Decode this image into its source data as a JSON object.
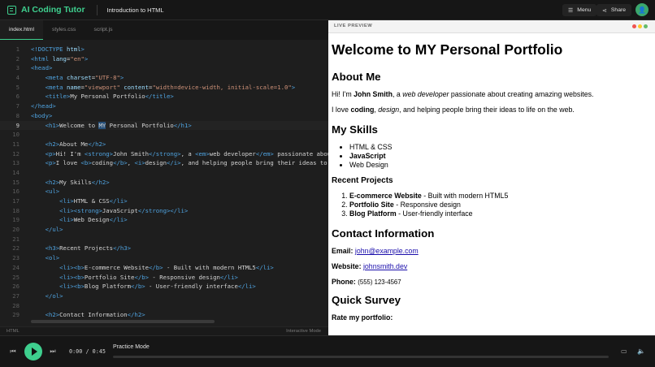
{
  "app": {
    "brand": "AI Coding Tutor",
    "lesson": "Introduction to HTML",
    "menu_label": "Menu",
    "share_label": "Share"
  },
  "colors": {
    "accent": "#3ecf8e",
    "tag": "#4fa3e0",
    "attr": "#9cdcfe",
    "string": "#ce9178",
    "editor_bg": "#1e1e1e"
  },
  "editor": {
    "tabs": [
      "index.html",
      "styles.css",
      "script.js"
    ],
    "active_tab": 0,
    "current_line": 9,
    "lines": [
      [
        [
          "t",
          "<!DOCTYPE "
        ],
        [
          "a",
          "html"
        ],
        [
          "t",
          ">"
        ]
      ],
      [
        [
          "t",
          "<html "
        ],
        [
          "a",
          "lang"
        ],
        [
          "x",
          "="
        ],
        [
          "s",
          "\"en\""
        ],
        [
          "t",
          ">"
        ]
      ],
      [
        [
          "t",
          "<head>"
        ]
      ],
      [
        [
          "x",
          "    "
        ],
        [
          "t",
          "<meta "
        ],
        [
          "a",
          "charset"
        ],
        [
          "x",
          "="
        ],
        [
          "s",
          "\"UTF-8\""
        ],
        [
          "t",
          ">"
        ]
      ],
      [
        [
          "x",
          "    "
        ],
        [
          "t",
          "<meta "
        ],
        [
          "a",
          "name"
        ],
        [
          "x",
          "="
        ],
        [
          "s",
          "\"viewport\""
        ],
        [
          "x",
          " "
        ],
        [
          "a",
          "content"
        ],
        [
          "x",
          "="
        ],
        [
          "s",
          "\"width=device-width, initial-scale=1.0\""
        ],
        [
          "t",
          ">"
        ]
      ],
      [
        [
          "x",
          "    "
        ],
        [
          "t",
          "<title>"
        ],
        [
          "x",
          "My Personal Portfolio"
        ],
        [
          "t",
          "</title>"
        ]
      ],
      [
        [
          "t",
          "</head>"
        ]
      ],
      [
        [
          "t",
          "<body>"
        ]
      ],
      [
        [
          "x",
          "    "
        ],
        [
          "t",
          "<h1>"
        ],
        [
          "x",
          "Welcome to "
        ],
        [
          "h",
          "MY"
        ],
        [
          "x",
          " Personal Portfolio"
        ],
        [
          "t",
          "</h1>"
        ]
      ],
      [
        [
          "x",
          ""
        ]
      ],
      [
        [
          "x",
          "    "
        ],
        [
          "t",
          "<h2>"
        ],
        [
          "x",
          "About Me"
        ],
        [
          "t",
          "</h2>"
        ]
      ],
      [
        [
          "x",
          "    "
        ],
        [
          "t",
          "<p>"
        ],
        [
          "x",
          "Hi! I'm "
        ],
        [
          "t",
          "<strong>"
        ],
        [
          "x",
          "John Smith"
        ],
        [
          "t",
          "</strong>"
        ],
        [
          "x",
          ", a "
        ],
        [
          "t",
          "<em>"
        ],
        [
          "x",
          "web developer"
        ],
        [
          "t",
          "</em>"
        ],
        [
          "x",
          " passionate about creating amazing websites."
        ],
        [
          "t",
          "</p>"
        ]
      ],
      [
        [
          "x",
          "    "
        ],
        [
          "t",
          "<p>"
        ],
        [
          "x",
          "I love "
        ],
        [
          "t",
          "<b>"
        ],
        [
          "x",
          "coding"
        ],
        [
          "t",
          "</b>"
        ],
        [
          "x",
          ", "
        ],
        [
          "t",
          "<i>"
        ],
        [
          "x",
          "design"
        ],
        [
          "t",
          "</i>"
        ],
        [
          "x",
          ", and helping people bring their ideas to life on the web."
        ],
        [
          "t",
          "</p>"
        ]
      ],
      [
        [
          "x",
          ""
        ]
      ],
      [
        [
          "x",
          "    "
        ],
        [
          "t",
          "<h2>"
        ],
        [
          "x",
          "My Skills"
        ],
        [
          "t",
          "</h2>"
        ]
      ],
      [
        [
          "x",
          "    "
        ],
        [
          "t",
          "<ul>"
        ]
      ],
      [
        [
          "x",
          "        "
        ],
        [
          "t",
          "<li>"
        ],
        [
          "x",
          "HTML & CSS"
        ],
        [
          "t",
          "</li>"
        ]
      ],
      [
        [
          "x",
          "        "
        ],
        [
          "t",
          "<li><strong>"
        ],
        [
          "x",
          "JavaScript"
        ],
        [
          "t",
          "</strong></li>"
        ]
      ],
      [
        [
          "x",
          "        "
        ],
        [
          "t",
          "<li>"
        ],
        [
          "x",
          "Web Design"
        ],
        [
          "t",
          "</li>"
        ]
      ],
      [
        [
          "x",
          "    "
        ],
        [
          "t",
          "</ul>"
        ]
      ],
      [
        [
          "x",
          ""
        ]
      ],
      [
        [
          "x",
          "    "
        ],
        [
          "t",
          "<h3>"
        ],
        [
          "x",
          "Recent Projects"
        ],
        [
          "t",
          "</h3>"
        ]
      ],
      [
        [
          "x",
          "    "
        ],
        [
          "t",
          "<ol>"
        ]
      ],
      [
        [
          "x",
          "        "
        ],
        [
          "t",
          "<li><b>"
        ],
        [
          "x",
          "E-commerce Website"
        ],
        [
          "t",
          "</b>"
        ],
        [
          "x",
          " - Built with modern HTML5"
        ],
        [
          "t",
          "</li>"
        ]
      ],
      [
        [
          "x",
          "        "
        ],
        [
          "t",
          "<li><b>"
        ],
        [
          "x",
          "Portfolio Site"
        ],
        [
          "t",
          "</b>"
        ],
        [
          "x",
          " - Responsive design"
        ],
        [
          "t",
          "</li>"
        ]
      ],
      [
        [
          "x",
          "        "
        ],
        [
          "t",
          "<li><b>"
        ],
        [
          "x",
          "Blog Platform"
        ],
        [
          "t",
          "</b>"
        ],
        [
          "x",
          " - User-friendly interface"
        ],
        [
          "t",
          "</li>"
        ]
      ],
      [
        [
          "x",
          "    "
        ],
        [
          "t",
          "</ol>"
        ]
      ],
      [
        [
          "x",
          ""
        ]
      ],
      [
        [
          "x",
          "    "
        ],
        [
          "t",
          "<h2>"
        ],
        [
          "x",
          "Contact Information"
        ],
        [
          "t",
          "</h2>"
        ]
      ]
    ],
    "status_left": "HTML",
    "status_right": "Interactive Mode"
  },
  "preview": {
    "header": "LIVE PREVIEW",
    "h1": "Welcome to MY Personal Portfolio",
    "about_h": "About Me",
    "p1_a": "Hi! I'm ",
    "p1_b": "John Smith",
    "p1_c": ", a ",
    "p1_d": "web developer",
    "p1_e": " passionate about creating amazing websites.",
    "p2_a": "I love ",
    "p2_b": "coding",
    "p2_c": ", ",
    "p2_d": "design",
    "p2_e": ", and helping people bring their ideas to life on the web.",
    "skills_h": "My Skills",
    "skills": [
      "HTML & CSS",
      "JavaScript",
      "Web Design"
    ],
    "projects_h": "Recent Projects",
    "projects": [
      {
        "name": "E-commerce Website",
        "desc": " - Built with modern HTML5"
      },
      {
        "name": "Portfolio Site",
        "desc": " - Responsive design"
      },
      {
        "name": "Blog Platform",
        "desc": " - User-friendly interface"
      }
    ],
    "contact_h": "Contact Information",
    "email_label": "Email:",
    "email": "john@example.com",
    "website_label": "Website:",
    "website": "johnsmith.dev",
    "phone_label": "Phone:",
    "phone": "(555) 123-4567",
    "survey_h": "Quick Survey",
    "rate_label": "Rate my portfolio:"
  },
  "player": {
    "time": "0:00 / 0:45",
    "mode": "Practice Mode",
    "progress": 0
  }
}
